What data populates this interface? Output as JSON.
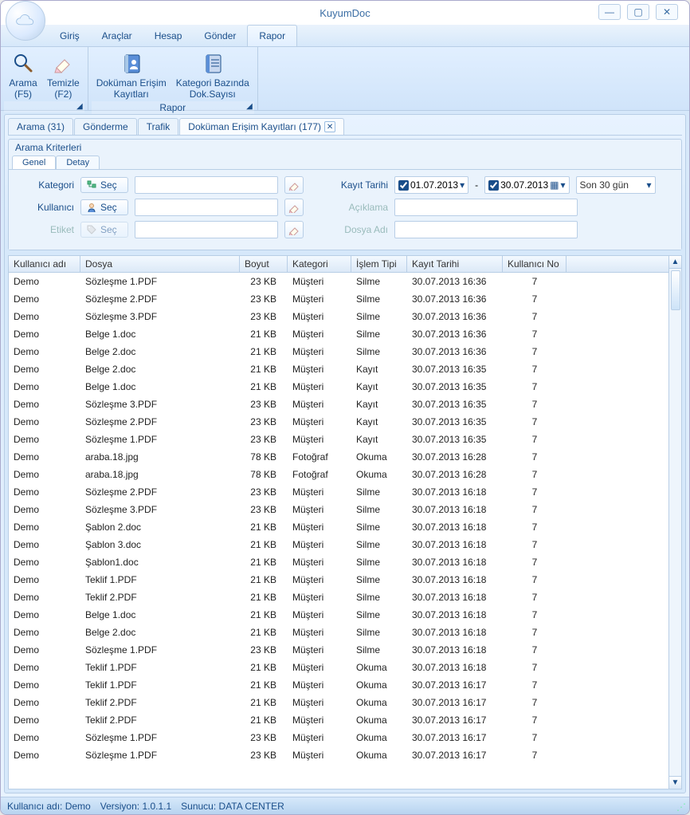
{
  "window": {
    "title": "KuyumDoc"
  },
  "menu": {
    "items": [
      "Giriş",
      "Araçlar",
      "Hesap",
      "Gönder",
      "Rapor"
    ],
    "active_index": 4
  },
  "ribbon": {
    "group1_label": "",
    "group2_label": "Rapor",
    "btn_search": "Arama\n(F5)",
    "btn_clear": "Temizle\n(F2)",
    "btn_doklog": "Doküman Erişim\nKayıtları",
    "btn_catcount": "Kategori Bazında\nDok.Sayısı"
  },
  "tabs": {
    "t1": "Arama (31)",
    "t2": "Gönderme",
    "t3": "Trafik",
    "t4": "Doküman Erişim Kayıtları (177)"
  },
  "criteria": {
    "title": "Arama Kriterleri",
    "tab_general": "Genel",
    "tab_detail": "Detay",
    "label_category": "Kategori",
    "label_user": "Kullanıcı",
    "label_tag": "Etiket",
    "label_recorddate": "Kayıt Tarihi",
    "label_desc": "Açıklama",
    "label_filename": "Dosya Adı",
    "btn_select": "Seç",
    "date_from": "01.07.2013",
    "date_to": "30.07.2013",
    "range_preset": "Son 30 gün"
  },
  "grid": {
    "columns": {
      "user": "Kullanıcı adı",
      "file": "Dosya",
      "size": "Boyut",
      "category": "Kategori",
      "optype": "İşlem Tipi",
      "recdate": "Kayıt Tarihi",
      "userno": "Kullanıcı No"
    },
    "rows": [
      {
        "user": "Demo",
        "file": "Sözleşme 1.PDF",
        "size": "23 KB",
        "cat": "Müşteri",
        "op": "Silme",
        "date": "30.07.2013 16:36",
        "uno": "7"
      },
      {
        "user": "Demo",
        "file": "Sözleşme 2.PDF",
        "size": "23 KB",
        "cat": "Müşteri",
        "op": "Silme",
        "date": "30.07.2013 16:36",
        "uno": "7"
      },
      {
        "user": "Demo",
        "file": "Sözleşme 3.PDF",
        "size": "23 KB",
        "cat": "Müşteri",
        "op": "Silme",
        "date": "30.07.2013 16:36",
        "uno": "7"
      },
      {
        "user": "Demo",
        "file": "Belge 1.doc",
        "size": "21 KB",
        "cat": "Müşteri",
        "op": "Silme",
        "date": "30.07.2013 16:36",
        "uno": "7"
      },
      {
        "user": "Demo",
        "file": "Belge 2.doc",
        "size": "21 KB",
        "cat": "Müşteri",
        "op": "Silme",
        "date": "30.07.2013 16:36",
        "uno": "7"
      },
      {
        "user": "Demo",
        "file": "Belge 2.doc",
        "size": "21 KB",
        "cat": "Müşteri",
        "op": "Kayıt",
        "date": "30.07.2013 16:35",
        "uno": "7"
      },
      {
        "user": "Demo",
        "file": "Belge 1.doc",
        "size": "21 KB",
        "cat": "Müşteri",
        "op": "Kayıt",
        "date": "30.07.2013 16:35",
        "uno": "7"
      },
      {
        "user": "Demo",
        "file": "Sözleşme 3.PDF",
        "size": "23 KB",
        "cat": "Müşteri",
        "op": "Kayıt",
        "date": "30.07.2013 16:35",
        "uno": "7"
      },
      {
        "user": "Demo",
        "file": "Sözleşme 2.PDF",
        "size": "23 KB",
        "cat": "Müşteri",
        "op": "Kayıt",
        "date": "30.07.2013 16:35",
        "uno": "7"
      },
      {
        "user": "Demo",
        "file": "Sözleşme 1.PDF",
        "size": "23 KB",
        "cat": "Müşteri",
        "op": "Kayıt",
        "date": "30.07.2013 16:35",
        "uno": "7"
      },
      {
        "user": "Demo",
        "file": "araba.18.jpg",
        "size": "78 KB",
        "cat": "Fotoğraf",
        "op": "Okuma",
        "date": "30.07.2013 16:28",
        "uno": "7"
      },
      {
        "user": "Demo",
        "file": "araba.18.jpg",
        "size": "78 KB",
        "cat": "Fotoğraf",
        "op": "Okuma",
        "date": "30.07.2013 16:28",
        "uno": "7"
      },
      {
        "user": "Demo",
        "file": "Sözleşme 2.PDF",
        "size": "23 KB",
        "cat": "Müşteri",
        "op": "Silme",
        "date": "30.07.2013 16:18",
        "uno": "7"
      },
      {
        "user": "Demo",
        "file": "Sözleşme 3.PDF",
        "size": "23 KB",
        "cat": "Müşteri",
        "op": "Silme",
        "date": "30.07.2013 16:18",
        "uno": "7"
      },
      {
        "user": "Demo",
        "file": "Şablon 2.doc",
        "size": "21 KB",
        "cat": "Müşteri",
        "op": "Silme",
        "date": "30.07.2013 16:18",
        "uno": "7"
      },
      {
        "user": "Demo",
        "file": "Şablon 3.doc",
        "size": "21 KB",
        "cat": "Müşteri",
        "op": "Silme",
        "date": "30.07.2013 16:18",
        "uno": "7"
      },
      {
        "user": "Demo",
        "file": "Şablon1.doc",
        "size": "21 KB",
        "cat": "Müşteri",
        "op": "Silme",
        "date": "30.07.2013 16:18",
        "uno": "7"
      },
      {
        "user": "Demo",
        "file": "Teklif 1.PDF",
        "size": "21 KB",
        "cat": "Müşteri",
        "op": "Silme",
        "date": "30.07.2013 16:18",
        "uno": "7"
      },
      {
        "user": "Demo",
        "file": "Teklif 2.PDF",
        "size": "21 KB",
        "cat": "Müşteri",
        "op": "Silme",
        "date": "30.07.2013 16:18",
        "uno": "7"
      },
      {
        "user": "Demo",
        "file": "Belge 1.doc",
        "size": "21 KB",
        "cat": "Müşteri",
        "op": "Silme",
        "date": "30.07.2013 16:18",
        "uno": "7"
      },
      {
        "user": "Demo",
        "file": "Belge 2.doc",
        "size": "21 KB",
        "cat": "Müşteri",
        "op": "Silme",
        "date": "30.07.2013 16:18",
        "uno": "7"
      },
      {
        "user": "Demo",
        "file": "Sözleşme 1.PDF",
        "size": "23 KB",
        "cat": "Müşteri",
        "op": "Silme",
        "date": "30.07.2013 16:18",
        "uno": "7"
      },
      {
        "user": "Demo",
        "file": "Teklif 1.PDF",
        "size": "21 KB",
        "cat": "Müşteri",
        "op": "Okuma",
        "date": "30.07.2013 16:18",
        "uno": "7"
      },
      {
        "user": "Demo",
        "file": "Teklif 1.PDF",
        "size": "21 KB",
        "cat": "Müşteri",
        "op": "Okuma",
        "date": "30.07.2013 16:17",
        "uno": "7"
      },
      {
        "user": "Demo",
        "file": "Teklif 2.PDF",
        "size": "21 KB",
        "cat": "Müşteri",
        "op": "Okuma",
        "date": "30.07.2013 16:17",
        "uno": "7"
      },
      {
        "user": "Demo",
        "file": "Teklif 2.PDF",
        "size": "21 KB",
        "cat": "Müşteri",
        "op": "Okuma",
        "date": "30.07.2013 16:17",
        "uno": "7"
      },
      {
        "user": "Demo",
        "file": "Sözleşme 1.PDF",
        "size": "23 KB",
        "cat": "Müşteri",
        "op": "Okuma",
        "date": "30.07.2013 16:17",
        "uno": "7"
      },
      {
        "user": "Demo",
        "file": "Sözleşme 1.PDF",
        "size": "23 KB",
        "cat": "Müşteri",
        "op": "Okuma",
        "date": "30.07.2013 16:17",
        "uno": "7"
      }
    ]
  },
  "status": {
    "user_label": "Kullanıcı adı:",
    "user_value": "Demo",
    "version_label": "Versiyon:",
    "version_value": "1.0.1.1",
    "server_label": "Sunucu:",
    "server_value": "DATA CENTER"
  }
}
